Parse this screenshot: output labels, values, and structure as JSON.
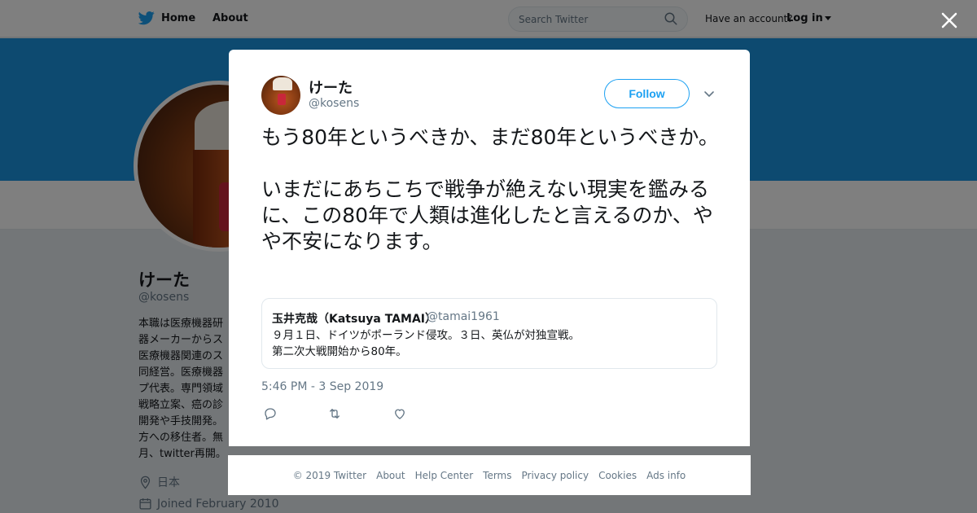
{
  "nav": {
    "home_label": "Home",
    "about_label": "About",
    "search_placeholder": "Search Twitter",
    "have_account": "Have an account?",
    "login_label": "Log in"
  },
  "profile": {
    "name": "けーた",
    "handle": "@kosens",
    "bio": "本職は医療機器研\n器メーカーからス\n医療機器関連のス\n同経営。医療機器\nプ代表。専門領域\n戦略立案、癌の診\n開発や手技開発。\n方への移住者。無\n月、twitter再開。",
    "location": "日本",
    "joined": "Joined February 2010"
  },
  "tweet": {
    "author_name": "けーた",
    "author_handle": "@kosens",
    "follow_label": "Follow",
    "text": "もう80年というべきか、まだ80年というべきか。\n\nいまだにあちこちで戦争が絶えない現実を鑑みるに、この80年で人類は進化したと言えるのか、やや不安になります。",
    "quoted": {
      "name": "玉井克哉（Katsuya TAMAI）",
      "handle": "@tamai1961",
      "text": "９月１日、ドイツがポーランド侵攻。３日、英仏が対独宣戦。\n第二次大戦開始から80年。"
    },
    "timestamp": "5:46 PM - 3 Sep 2019"
  },
  "footer": {
    "links": [
      "© 2019 Twitter",
      "About",
      "Help Center",
      "Terms",
      "Privacy policy",
      "Cookies",
      "Ads info"
    ]
  },
  "colors": {
    "brand_blue": "#1da1f2",
    "banner_blue": "#1b95e0"
  },
  "icons": [
    "twitter-bird-icon",
    "search-icon",
    "close-icon",
    "chevron-down-icon",
    "reply-icon",
    "retweet-icon",
    "like-icon",
    "location-icon",
    "calendar-icon"
  ]
}
